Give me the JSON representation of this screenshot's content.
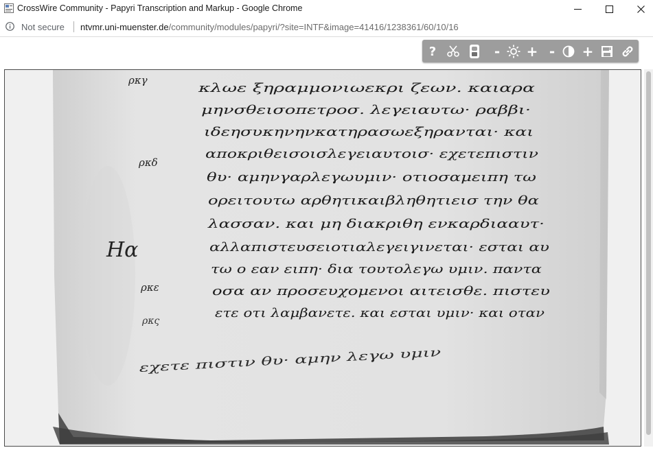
{
  "window": {
    "title": "CrossWire Community - Papyri Transcription and Markup - Google Chrome"
  },
  "addressbar": {
    "security_label": "Not secure",
    "url_host": "ntvmr.uni-muenster.de",
    "url_path": "/community/modules/papyri/?site=INTF&image=41416/1238361/60/10/16"
  },
  "toolbar": {
    "buttons": [
      {
        "icon": "help-icon",
        "glyph": "?"
      },
      {
        "icon": "scissors-icon"
      },
      {
        "icon": "image-toggle-icon"
      },
      {
        "icon": "brightness-decrease-icon",
        "glyph": "-"
      },
      {
        "icon": "brightness-icon"
      },
      {
        "icon": "brightness-increase-icon",
        "glyph": "+"
      },
      {
        "icon": "contrast-decrease-icon",
        "glyph": "-"
      },
      {
        "icon": "contrast-icon"
      },
      {
        "icon": "contrast-increase-icon",
        "glyph": "+"
      },
      {
        "icon": "save-image-icon"
      },
      {
        "icon": "link-icon"
      }
    ]
  },
  "manuscript": {
    "margin_notes": [
      "ρκγ",
      "ρκδ",
      "Ηα",
      "ρκε",
      "ρκς"
    ],
    "lines": [
      "κλωε ξηραμμονιωεκρι ζεων. καιαρα",
      "μηνσθεισοπετροσ. λεγειαυτω· ραββι·",
      "ιδεησυκηνηνκατηρασωεξηρανται· και",
      "αποκριθεισοισλεγειαυτοισ· εχετεπιστιν",
      "θυ· αμηνγαρλεγωυμιν· οτιοσαμειπη τω",
      "ορειτουτω αρθητικαιβληθητιεισ την θα",
      "λασσαν. και μη διακριθη ενκαρδιααυτ·",
      "αλλαπιστευσειοτιαλεγειγινεται· εσται αυ",
      "τω ο εαν ειπη· δια τουτολεγω υμιν. παντα",
      "οσα αν προσευχομενοι αιτεισθε. πιστευ",
      "ετε οτι λαμβανετε. και εσται υμιν· και οταν"
    ],
    "footer_note": "εχετε πιστιν θυ· αμην λεγω υμιν"
  }
}
